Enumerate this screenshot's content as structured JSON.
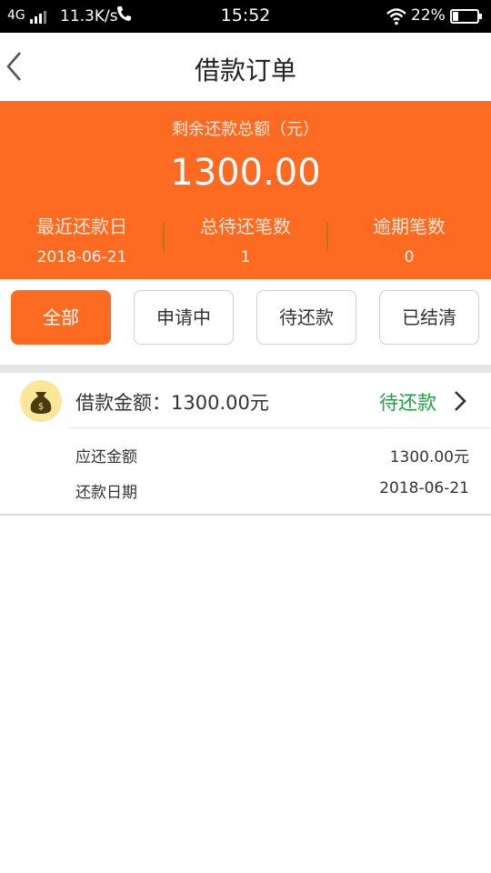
{
  "status_bar": {
    "network": "4G",
    "speed": "11.3K/s",
    "time": "15:52",
    "battery": "22%"
  },
  "nav": {
    "title": "借款订单"
  },
  "summary": {
    "label": "剩余还款总额（元）",
    "amount": "1300.00",
    "stats": [
      {
        "title": "最近还款日",
        "value": "2018-06-21"
      },
      {
        "title": "总待还笔数",
        "value": "1"
      },
      {
        "title": "逾期笔数",
        "value": "0"
      }
    ]
  },
  "tabs": [
    {
      "label": "全部",
      "active": true
    },
    {
      "label": "申请中",
      "active": false
    },
    {
      "label": "待还款",
      "active": false
    },
    {
      "label": "已结清",
      "active": false
    }
  ],
  "order": {
    "icon": "money-bag-icon",
    "amount_label": "借款金额：1300.00元",
    "status": "待还款",
    "rows": [
      {
        "key": "应还金额",
        "value": "1300.00元"
      },
      {
        "key": "还款日期",
        "value": "2018-06-21"
      }
    ]
  },
  "colors": {
    "accent": "#fd6a22",
    "status_green": "#1fa23f"
  }
}
